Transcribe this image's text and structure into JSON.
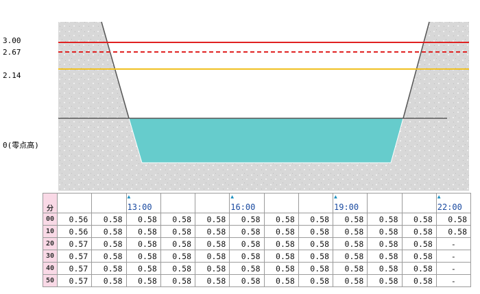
{
  "levels": {
    "l300": "3.00",
    "l267": "2.67",
    "l214": "2.14",
    "zero": "0(零点高)"
  },
  "colors": {
    "red_line": "#e02020",
    "yellow_line": "#f0c020",
    "water": "#66cccc",
    "ground": "#d6d6d6",
    "header_bg": "#f9d9e6"
  },
  "table": {
    "minute_header": "分",
    "time_labels": [
      "",
      "",
      "13:00",
      "",
      "",
      "16:00",
      "",
      "",
      "19:00",
      "",
      "",
      "22:00"
    ],
    "tick_marker": "▲",
    "rows": [
      {
        "minute": "00",
        "values": [
          "0.56",
          "0.58",
          "0.58",
          "0.58",
          "0.58",
          "0.58",
          "0.58",
          "0.58",
          "0.58",
          "0.58",
          "0.58",
          "0.58"
        ]
      },
      {
        "minute": "10",
        "values": [
          "0.56",
          "0.58",
          "0.58",
          "0.58",
          "0.58",
          "0.58",
          "0.58",
          "0.58",
          "0.58",
          "0.58",
          "0.58",
          "0.58"
        ]
      },
      {
        "minute": "20",
        "values": [
          "0.57",
          "0.58",
          "0.58",
          "0.58",
          "0.58",
          "0.58",
          "0.58",
          "0.58",
          "0.58",
          "0.58",
          "0.58",
          "-"
        ]
      },
      {
        "minute": "30",
        "values": [
          "0.57",
          "0.58",
          "0.58",
          "0.58",
          "0.58",
          "0.58",
          "0.58",
          "0.58",
          "0.58",
          "0.58",
          "0.58",
          "-"
        ]
      },
      {
        "minute": "40",
        "values": [
          "0.57",
          "0.58",
          "0.58",
          "0.58",
          "0.58",
          "0.58",
          "0.58",
          "0.58",
          "0.58",
          "0.58",
          "0.58",
          "-"
        ]
      },
      {
        "minute": "50",
        "values": [
          "0.57",
          "0.58",
          "0.58",
          "0.58",
          "0.58",
          "0.58",
          "0.58",
          "0.58",
          "0.58",
          "0.58",
          "0.58",
          "-"
        ]
      }
    ]
  }
}
